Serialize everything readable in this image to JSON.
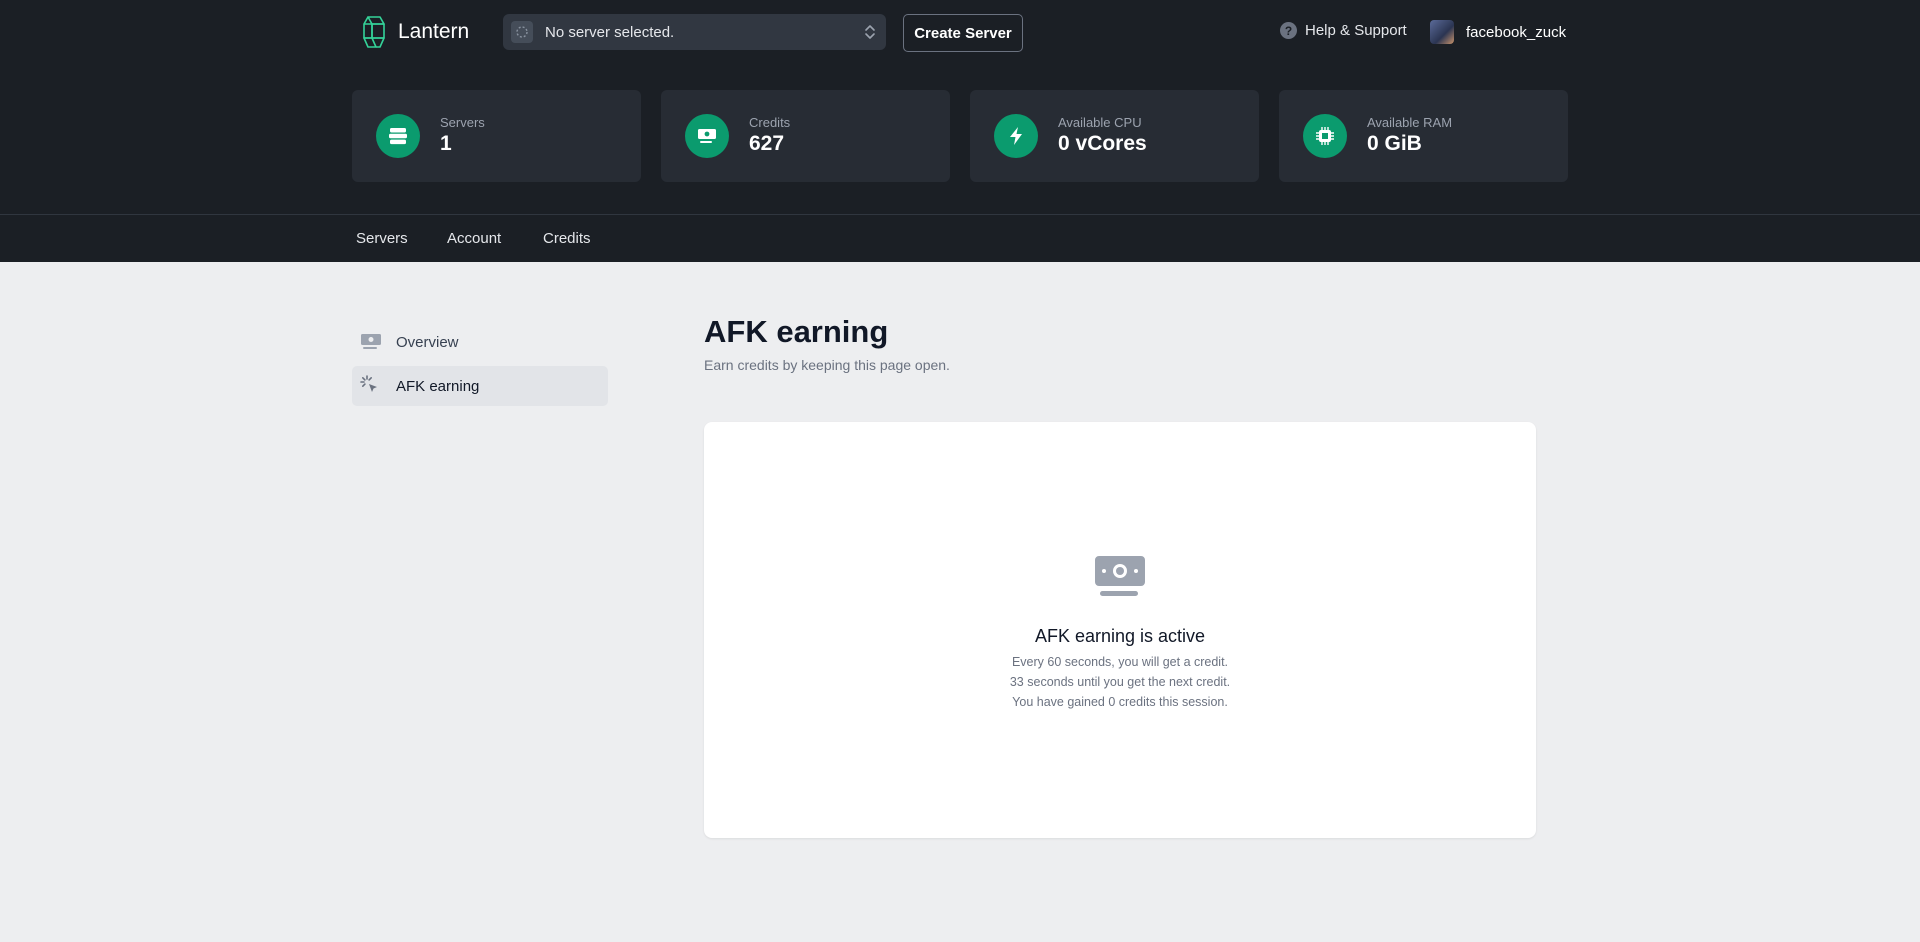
{
  "app": {
    "name": "Lantern"
  },
  "header": {
    "server_select": {
      "label": "No server selected."
    },
    "create_server_label": "Create Server",
    "help_label": "Help & Support",
    "username": "facebook_zuck"
  },
  "stats": [
    {
      "label": "Servers",
      "value": "1",
      "icon": "servers-icon"
    },
    {
      "label": "Credits",
      "value": "627",
      "icon": "credits-icon"
    },
    {
      "label": "Available CPU",
      "value": "0 vCores",
      "icon": "lightning-icon"
    },
    {
      "label": "Available RAM",
      "value": "0 GiB",
      "icon": "chip-icon"
    }
  ],
  "nav": {
    "items": [
      "Servers",
      "Account",
      "Credits"
    ]
  },
  "sidebar": {
    "items": [
      {
        "label": "Overview",
        "icon": "banknote-icon",
        "active": false
      },
      {
        "label": "AFK earning",
        "icon": "cursor-click-icon",
        "active": true
      }
    ]
  },
  "main": {
    "title": "AFK earning",
    "subtitle": "Earn credits by keeping this page open.",
    "card": {
      "title": "AFK earning is active",
      "lines": [
        "Every 60 seconds, you will get a credit.",
        "33 seconds until you get the next credit.",
        "You have gained 0 credits this session."
      ]
    }
  },
  "colors": {
    "header_bg": "#1b1f25",
    "accent": "#0b9b6e",
    "page_bg": "#edeef0"
  }
}
